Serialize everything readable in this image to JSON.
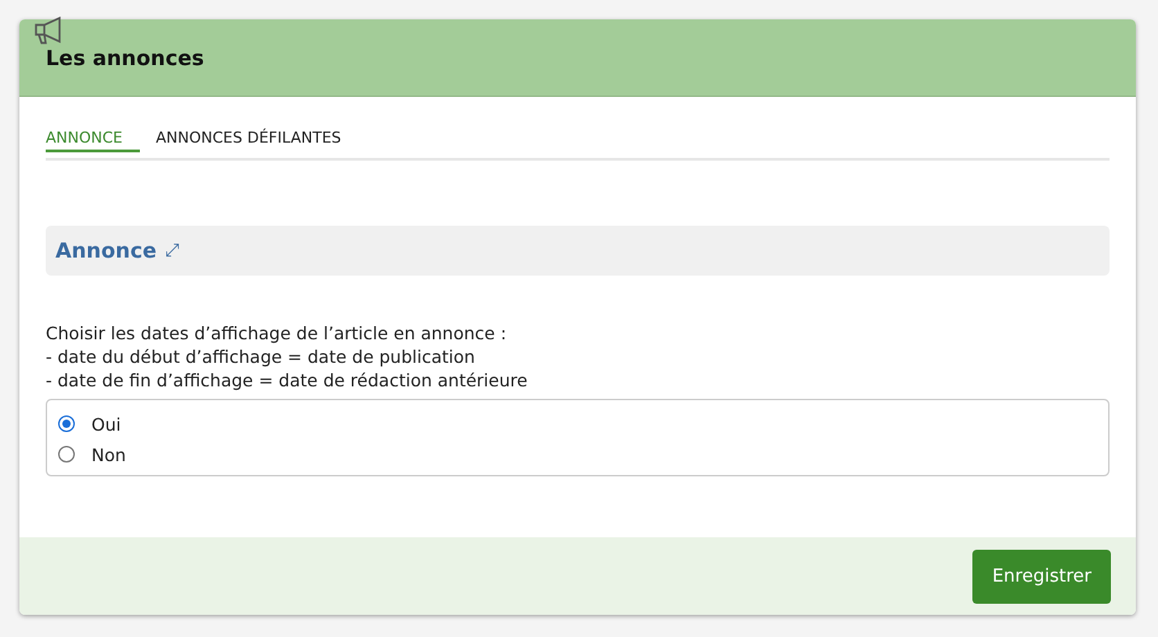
{
  "panel": {
    "title": "Les annonces"
  },
  "tabs": [
    {
      "label": "ANNONCE",
      "selected": true
    },
    {
      "label": "ANNONCES DÉFILANTES",
      "selected": false
    }
  ],
  "section": {
    "title": "Annonce",
    "link_icon": "⤢"
  },
  "description": [
    "Choisir les dates d’affichage de l’article en annonce :",
    "- date du début d’affichage = date de publication",
    "- date de fin d’affichage = date de rédaction antérieure"
  ],
  "options": [
    {
      "label": "Oui",
      "selected": true
    },
    {
      "label": "Non",
      "selected": false
    }
  ],
  "buttons": [
    "Enregistrer"
  ]
}
